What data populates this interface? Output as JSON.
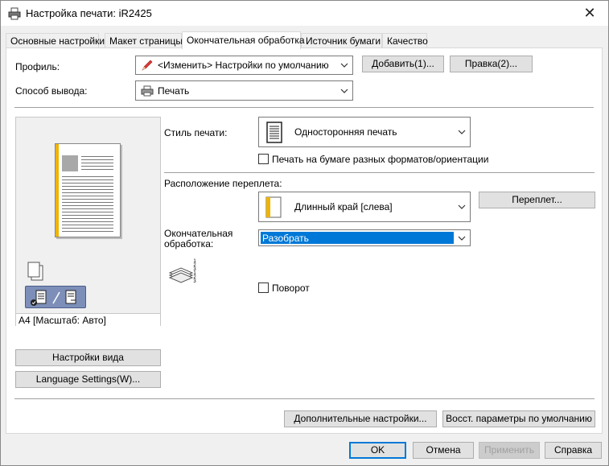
{
  "window": {
    "title": "Настройка печати: iR2425",
    "close_glyph": "✕"
  },
  "tabs": [
    {
      "label": "Основные настройки",
      "active": false
    },
    {
      "label": "Макет страницы",
      "active": false
    },
    {
      "label": "Окончательная обработка",
      "active": true
    },
    {
      "label": "Источник бумаги",
      "active": false
    },
    {
      "label": "Качество",
      "active": false
    }
  ],
  "profile": {
    "label": "Профиль:",
    "value": "<Изменить> Настройки по умолчанию",
    "add_button": "Добавить(1)...",
    "edit_button": "Правка(2)..."
  },
  "output": {
    "label": "Способ вывода:",
    "value": "Печать"
  },
  "preview": {
    "caption": "A4 [Масштаб: Авто]",
    "view_settings_button": "Настройки вида",
    "language_settings_button": "Language Settings(W)..."
  },
  "print_style": {
    "label": "Стиль печати:",
    "value": "Односторонняя печать",
    "mixed_paper_label": "Печать на бумаге разных форматов/ориентации",
    "mixed_paper_checked": false
  },
  "binding": {
    "label": "Расположение переплета:",
    "value": "Длинный край [слева]",
    "gutter_button": "Переплет..."
  },
  "finishing": {
    "label_line1": "Окончательная",
    "label_line2": "обработка:",
    "value": "Разобрать",
    "rotate_label": "Поворот",
    "rotate_checked": false,
    "collate_numbers": "1 2 3 1 2 3"
  },
  "bottom": {
    "advanced_button": "Дополнительные настройки...",
    "restore_button": "Восст. параметры по умолчанию"
  },
  "dialog_buttons": {
    "ok": "OK",
    "cancel": "Отмена",
    "apply": "Применить",
    "help": "Справка"
  },
  "colors": {
    "accent": "#0078d7",
    "binding_bar": "#f0b400",
    "selection": "#0078d7"
  }
}
